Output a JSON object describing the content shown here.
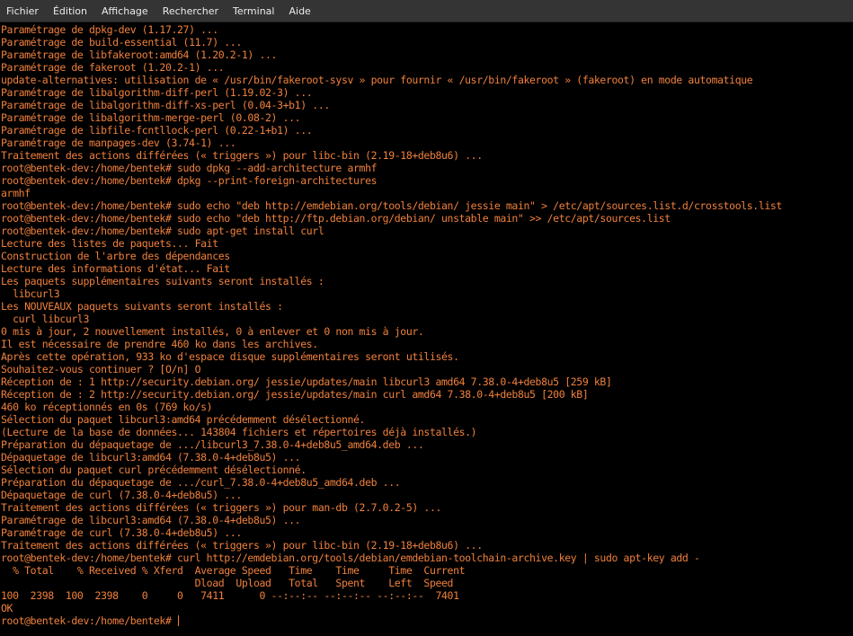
{
  "menubar": {
    "items": [
      "Fichier",
      "Édition",
      "Affichage",
      "Rechercher",
      "Terminal",
      "Aide"
    ]
  },
  "terminal": {
    "text_color": "#f0803c",
    "background": "#000000",
    "lines": [
      "Paramétrage de dpkg-dev (1.17.27) ...",
      "Paramétrage de build-essential (11.7) ...",
      "Paramétrage de libfakeroot:amd64 (1.20.2-1) ...",
      "Paramétrage de fakeroot (1.20.2-1) ...",
      "update-alternatives: utilisation de « /usr/bin/fakeroot-sysv » pour fournir « /usr/bin/fakeroot » (fakeroot) en mode automatique",
      "Paramétrage de libalgorithm-diff-perl (1.19.02-3) ...",
      "Paramétrage de libalgorithm-diff-xs-perl (0.04-3+b1) ...",
      "Paramétrage de libalgorithm-merge-perl (0.08-2) ...",
      "Paramétrage de libfile-fcntllock-perl (0.22-1+b1) ...",
      "Paramétrage de manpages-dev (3.74-1) ...",
      "Traitement des actions différées (« triggers ») pour libc-bin (2.19-18+deb8u6) ...",
      "root@bentek-dev:/home/bentek# sudo dpkg --add-architecture armhf",
      "root@bentek-dev:/home/bentek# dpkg --print-foreign-architectures",
      "armhf",
      "root@bentek-dev:/home/bentek# sudo echo \"deb http://emdebian.org/tools/debian/ jessie main\" > /etc/apt/sources.list.d/crosstools.list",
      "root@bentek-dev:/home/bentek# sudo echo \"deb http://ftp.debian.org/debian/ unstable main\" >> /etc/apt/sources.list",
      "root@bentek-dev:/home/bentek# sudo apt-get install curl",
      "Lecture des listes de paquets... Fait",
      "Construction de l'arbre des dépendances",
      "Lecture des informations d'état... Fait",
      "Les paquets supplémentaires suivants seront installés :",
      "  libcurl3",
      "Les NOUVEAUX paquets suivants seront installés :",
      "  curl libcurl3",
      "0 mis à jour, 2 nouvellement installés, 0 à enlever et 0 non mis à jour.",
      "Il est nécessaire de prendre 460 ko dans les archives.",
      "Après cette opération, 933 ko d'espace disque supplémentaires seront utilisés.",
      "Souhaitez-vous continuer ? [O/n] O",
      "Réception de : 1 http://security.debian.org/ jessie/updates/main libcurl3 amd64 7.38.0-4+deb8u5 [259 kB]",
      "Réception de : 2 http://security.debian.org/ jessie/updates/main curl amd64 7.38.0-4+deb8u5 [200 kB]",
      "460 ko réceptionnés en 0s (769 ko/s)",
      "Sélection du paquet libcurl3:amd64 précédemment désélectionné.",
      "(Lecture de la base de données... 143804 fichiers et répertoires déjà installés.)",
      "Préparation du dépaquetage de .../libcurl3_7.38.0-4+deb8u5_amd64.deb ...",
      "Dépaquetage de libcurl3:amd64 (7.38.0-4+deb8u5) ...",
      "Sélection du paquet curl précédemment désélectionné.",
      "Préparation du dépaquetage de .../curl_7.38.0-4+deb8u5_amd64.deb ...",
      "Dépaquetage de curl (7.38.0-4+deb8u5) ...",
      "Traitement des actions différées (« triggers ») pour man-db (2.7.0.2-5) ...",
      "Paramétrage de libcurl3:amd64 (7.38.0-4+deb8u5) ...",
      "Paramétrage de curl (7.38.0-4+deb8u5) ...",
      "Traitement des actions différées (« triggers ») pour libc-bin (2.19-18+deb8u6) ...",
      "root@bentek-dev:/home/bentek# curl http://emdebian.org/tools/debian/emdebian-toolchain-archive.key | sudo apt-key add -",
      "  % Total    % Received % Xferd  Average Speed   Time    Time     Time  Current",
      "                                 Dload  Upload   Total   Spent    Left  Speed",
      "100  2398  100  2398    0     0   7411      0 --:--:-- --:--:-- --:--:--  7401",
      "OK"
    ],
    "prompt": "root@bentek-dev:/home/bentek# "
  }
}
